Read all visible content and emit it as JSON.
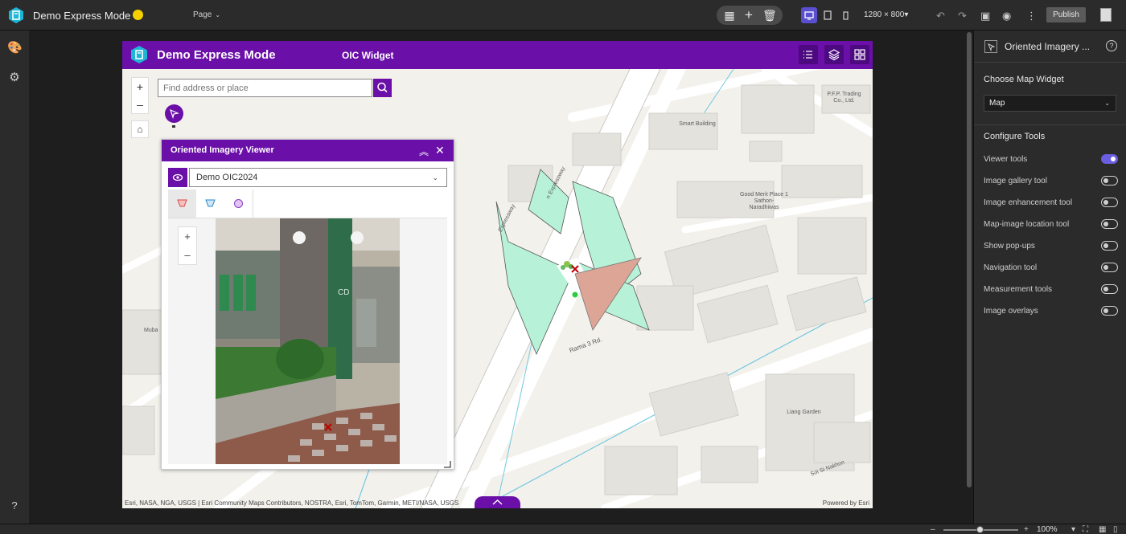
{
  "topbar": {
    "app_title": "Demo Express Mode",
    "page_label": "Page",
    "resolution": "1280 × 800",
    "publish_label": "Publish"
  },
  "app": {
    "title": "Demo Express Mode",
    "widget_title": "OIC Widget",
    "search_placeholder": "Find address or place",
    "attribution": "Esri, NASA, NGA, USGS | Esri Community Maps Contributors, NOSTRA, Esri, TomTom, Garmin, METI/NASA, USGS",
    "powered_by": "Powered by Esri",
    "zoom_in": "+",
    "zoom_out": "–",
    "map_labels": [
      {
        "text": "P.F.P. Trading Co., Ltd."
      },
      {
        "text": "Smart Building"
      },
      {
        "text": "Good Merit Place 1 Sathon-Naradhiwas"
      },
      {
        "text": "Rama 3 Rd."
      },
      {
        "text": "Liang Garden"
      },
      {
        "text": "Soi Si Nakhon"
      },
      {
        "text": "Expressway"
      },
      {
        "text": "n Expressway"
      },
      {
        "text": "Muba"
      }
    ]
  },
  "viewer": {
    "title": "Oriented Imagery Viewer",
    "layer_selected": "Demo OIC2024",
    "zoom_in": "+",
    "zoom_out": "–"
  },
  "right_panel": {
    "title": "Oriented Imagery ...",
    "choose_map_label": "Choose Map Widget",
    "map_selected": "Map",
    "configure_label": "Configure Tools",
    "options": [
      {
        "label": "Viewer tools",
        "on": true
      },
      {
        "label": "Image gallery tool",
        "on": false
      },
      {
        "label": "Image enhancement tool",
        "on": false
      },
      {
        "label": "Map-image location tool",
        "on": false
      },
      {
        "label": "Show pop-ups",
        "on": false
      },
      {
        "label": "Navigation tool",
        "on": false
      },
      {
        "label": "Measurement tools",
        "on": false
      },
      {
        "label": "Image overlays",
        "on": false
      }
    ]
  },
  "statusbar": {
    "zoom_percent": "100%"
  },
  "colors": {
    "brand_purple": "#6a0fa8",
    "toggle_on": "#6a5fe0",
    "footprint_green": "#b7f2d8",
    "footprint_red": "#dca596"
  }
}
